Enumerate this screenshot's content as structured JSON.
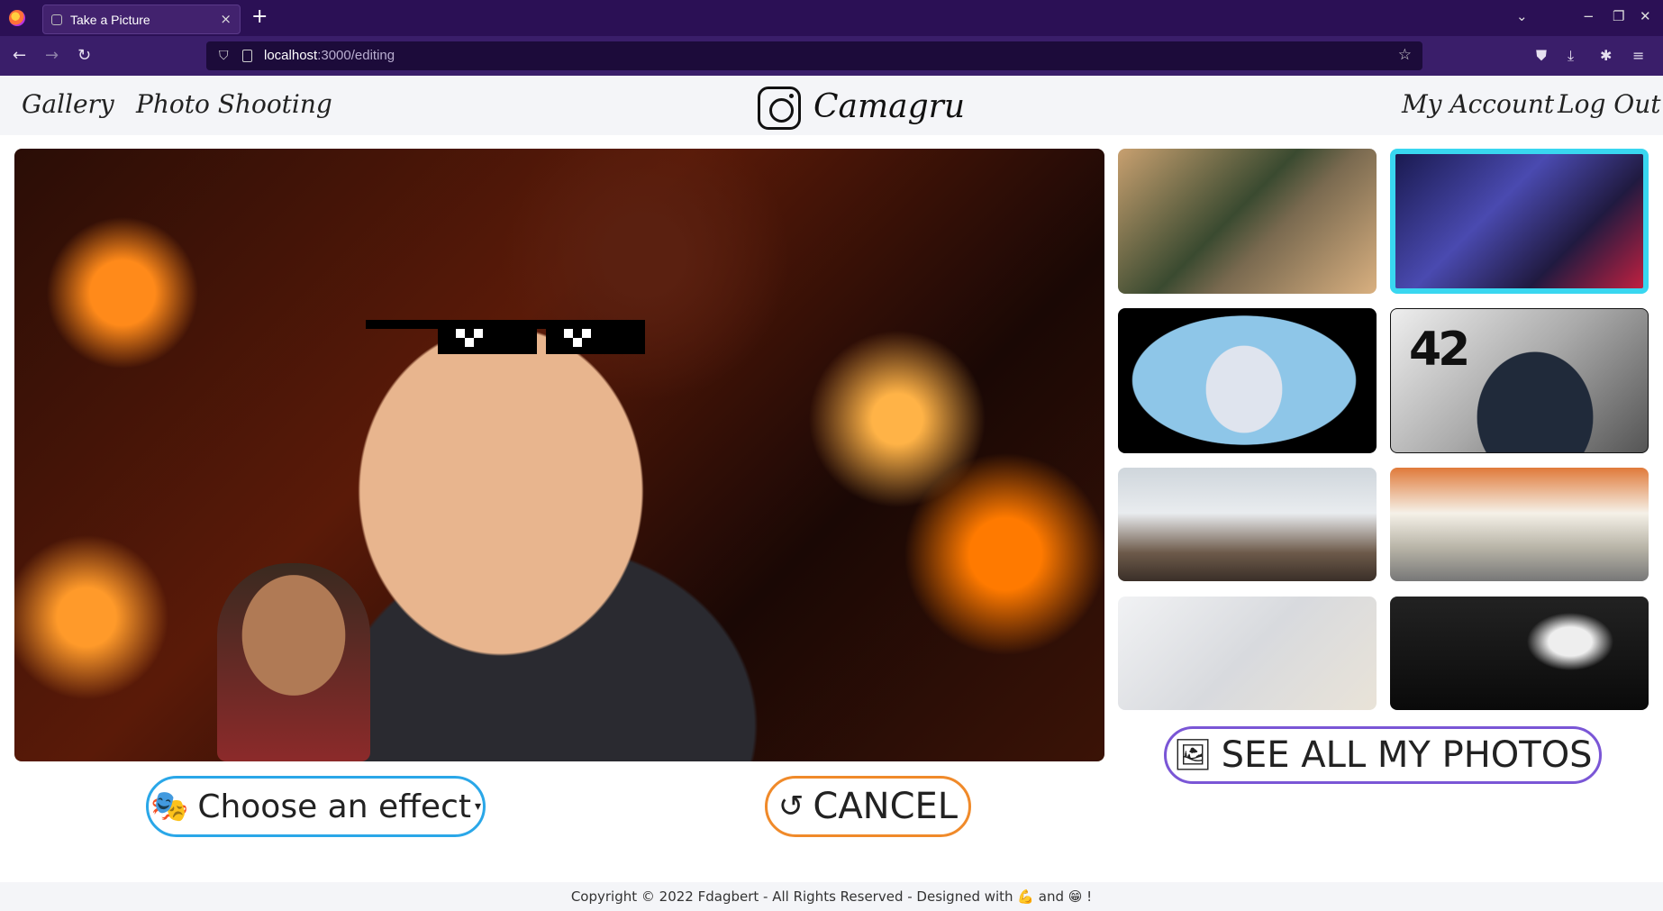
{
  "browser": {
    "tab_title": "Take a Picture",
    "new_tab": "+",
    "tab_close": "×",
    "url_host": "localhost",
    "url_path": ":3000/editing",
    "window_controls": [
      "−",
      "❐",
      "✕"
    ]
  },
  "nav": {
    "gallery": "Gallery",
    "photo_shooting": "Photo Shooting",
    "brand": "Camagru",
    "my_account": "My Account",
    "log_out": "Log Out"
  },
  "sidebar": {
    "special_thumb_text": "42"
  },
  "actions": {
    "see_all": "SEE ALL MY PHOTOS",
    "effect": "Choose an effect",
    "cancel": "CANCEL"
  },
  "footer": {
    "text": "Copyright © 2022 Fdagbert - All Rights Reserved - Designed with 💪 and 😁 !"
  },
  "colors": {
    "see_all_border": "#7a56d6",
    "effect_border": "#2aa7e8",
    "cancel_border": "#f08a2a"
  }
}
